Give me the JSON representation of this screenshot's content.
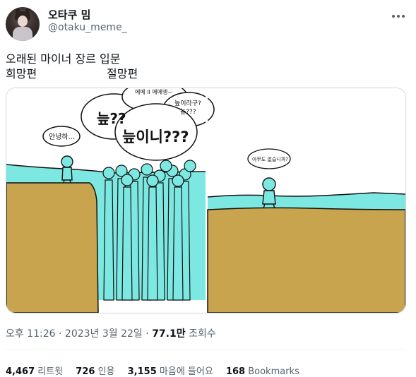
{
  "author": {
    "display_name": "오타쿠 밈",
    "handle": "@otaku_meme_"
  },
  "tweet": {
    "line1": "오래된 마이너 장르 입문",
    "line2_left": "희망편",
    "line2_right": "절망편"
  },
  "image": {
    "left_panel": {
      "bubble_hello": "안녕하...",
      "bubble_1": "늪??",
      "bubble_2": "늪이니???",
      "bubble_3": "에에 ll 에에엥~",
      "bubble_4": "늪이라구?",
      "bubble_5": "늪???"
    },
    "right_panel": {
      "bubble": "아무도 없습니까?"
    },
    "colors": {
      "water": "#7de8e2",
      "ground": "#c9a44e",
      "outline": "#111111"
    }
  },
  "meta": {
    "time": "오후 11:26",
    "date": "2023년 3월 22일",
    "views_count": "77.1만",
    "views_label": "조회수"
  },
  "stats": {
    "retweets_count": "4,467",
    "retweets_label": "리트윗",
    "quotes_count": "726",
    "quotes_label": "인용",
    "likes_count": "3,155",
    "likes_label": "마음에 들어요",
    "bookmarks_count": "168",
    "bookmarks_label": "Bookmarks"
  }
}
